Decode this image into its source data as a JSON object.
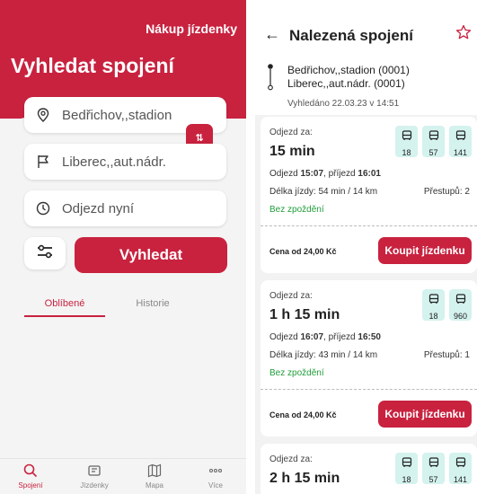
{
  "left": {
    "buy_ticket_link": "Nákup jízdenky",
    "title": "Vyhledat spojení",
    "from_value": "Bedřichov,,stadion",
    "to_value": "Liberec,,aut.nádr.",
    "time_value": "Odjezd nyní",
    "swap_icon": "swap-vertical-icon",
    "search_button": "Vyhledat",
    "tabs": [
      "Oblíbené",
      "Historie"
    ],
    "bottom_nav": [
      "Spojení",
      "Jízdenky",
      "Mapa",
      "Více"
    ]
  },
  "right": {
    "title": "Nalezená spojení",
    "route_from": "Bedřichov,,stadion (0001)",
    "route_to": "Liberec,,aut.nádr. (0001)",
    "searched_at": "Vyhledáno 22.03.23 v 14:51",
    "connections": [
      {
        "label": "Odjezd za:",
        "time_to_departure": "15 min",
        "departure_prefix": "Odjezd ",
        "departure_time": "15:07",
        "arrival_prefix": ", příjezd ",
        "arrival_time": "16:01",
        "duration": "Délka jízdy: 54 min / 14 km",
        "transfers": "Přestupů: 2",
        "delay_status": "Bez zpoždění",
        "price": "Cena od 24,00 Kč",
        "buy_button": "Koupit jízdenku",
        "lines": [
          "18",
          "57",
          "141"
        ]
      },
      {
        "label": "Odjezd za:",
        "time_to_departure": "1 h 15 min",
        "departure_prefix": "Odjezd ",
        "departure_time": "16:07",
        "arrival_prefix": ", příjezd ",
        "arrival_time": "16:50",
        "duration": "Délka jízdy: 43 min / 14 km",
        "transfers": "Přestupů: 1",
        "delay_status": "Bez zpoždění",
        "price": "Cena od 24,00 Kč",
        "buy_button": "Koupit jízdenku",
        "lines": [
          "18",
          "960"
        ]
      },
      {
        "label": "Odjezd za:",
        "time_to_departure": "2 h 15 min",
        "lines": [
          "18",
          "57",
          "141"
        ]
      }
    ]
  },
  "colors": {
    "brand_red": "#c8223f",
    "line_badge": "#d4f2ee",
    "on_time_green": "#1f9d3a"
  }
}
